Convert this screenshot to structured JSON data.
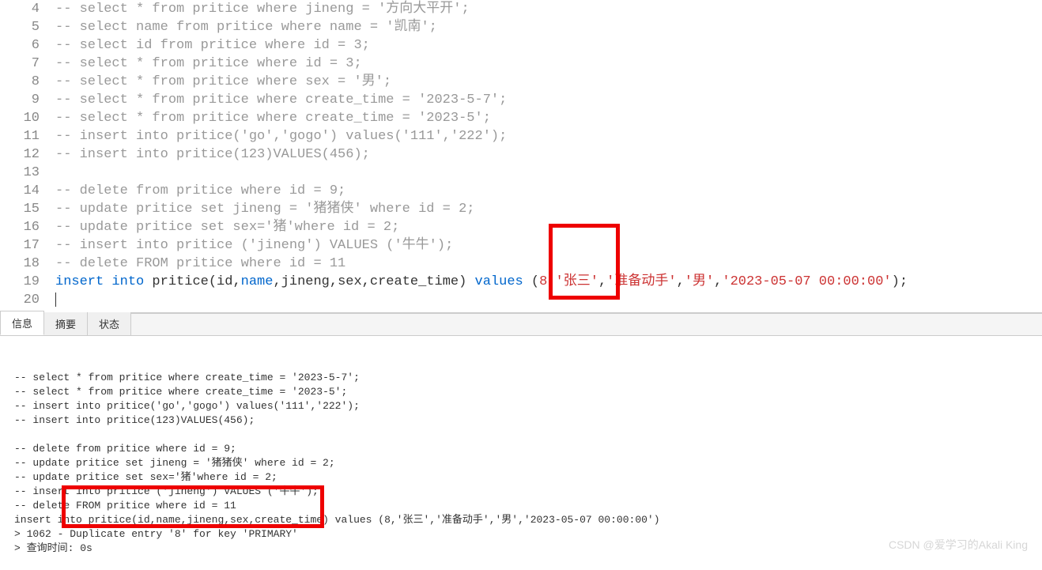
{
  "editor": {
    "lines": [
      {
        "num": "4",
        "segments": [
          {
            "cls": "comment",
            "text": "-- select * from pritice where jineng = '方向大平开';"
          }
        ]
      },
      {
        "num": "5",
        "segments": [
          {
            "cls": "comment",
            "text": "-- select name from pritice where name = '凯南';"
          }
        ]
      },
      {
        "num": "6",
        "segments": [
          {
            "cls": "comment",
            "text": "-- select id from pritice where id = 3;"
          }
        ]
      },
      {
        "num": "7",
        "segments": [
          {
            "cls": "comment",
            "text": "-- select * from pritice where id = 3;"
          }
        ]
      },
      {
        "num": "8",
        "segments": [
          {
            "cls": "comment",
            "text": "-- select * from pritice where sex = '男';"
          }
        ]
      },
      {
        "num": "9",
        "segments": [
          {
            "cls": "comment",
            "text": "-- select * from pritice where create_time = '2023-5-7';"
          }
        ]
      },
      {
        "num": "10",
        "segments": [
          {
            "cls": "comment",
            "text": "-- select * from pritice where create_time = '2023-5';"
          }
        ]
      },
      {
        "num": "11",
        "segments": [
          {
            "cls": "comment",
            "text": "-- insert into pritice('go','gogo') values('111','222');"
          }
        ]
      },
      {
        "num": "12",
        "segments": [
          {
            "cls": "comment",
            "text": "-- insert into pritice(123)VALUES(456);"
          }
        ]
      },
      {
        "num": "13",
        "segments": []
      },
      {
        "num": "14",
        "segments": [
          {
            "cls": "comment",
            "text": "-- delete from pritice where id = 9;"
          }
        ]
      },
      {
        "num": "15",
        "segments": [
          {
            "cls": "comment",
            "text": "-- update pritice set jineng = '猪猪侠' where id = 2;"
          }
        ]
      },
      {
        "num": "16",
        "segments": [
          {
            "cls": "comment",
            "text": "-- update pritice set sex='猪'where id = 2;"
          }
        ]
      },
      {
        "num": "17",
        "segments": [
          {
            "cls": "comment",
            "text": "-- insert into pritice ('jineng') VALUES ('牛牛');"
          }
        ]
      },
      {
        "num": "18",
        "segments": [
          {
            "cls": "comment",
            "text": "-- delete FROM pritice where id = 11"
          }
        ]
      },
      {
        "num": "19",
        "segments": [
          {
            "cls": "keyword",
            "text": "insert"
          },
          {
            "cls": "normal",
            "text": " "
          },
          {
            "cls": "keyword",
            "text": "into"
          },
          {
            "cls": "normal",
            "text": " pritice(id,"
          },
          {
            "cls": "keyword",
            "text": "name"
          },
          {
            "cls": "normal",
            "text": ",jineng,sex,create_time) "
          },
          {
            "cls": "keyword",
            "text": "values"
          },
          {
            "cls": "normal",
            "text": " ("
          },
          {
            "cls": "string",
            "text": "8"
          },
          {
            "cls": "normal",
            "text": ","
          },
          {
            "cls": "string",
            "text": "'张三'"
          },
          {
            "cls": "normal",
            "text": ","
          },
          {
            "cls": "string",
            "text": "'准备动手'"
          },
          {
            "cls": "normal",
            "text": ","
          },
          {
            "cls": "string",
            "text": "'男'"
          },
          {
            "cls": "normal",
            "text": ","
          },
          {
            "cls": "string",
            "text": "'2023-05-07 00:00:00'"
          },
          {
            "cls": "normal",
            "text": ");"
          }
        ]
      },
      {
        "num": "20",
        "segments": [],
        "cursor": true
      }
    ]
  },
  "tabs": {
    "items": [
      "信息",
      "摘要",
      "状态"
    ],
    "activeIndex": 0
  },
  "output": {
    "lines": [
      "-- select * from pritice where create_time = '2023-5-7';",
      "-- select * from pritice where create_time = '2023-5';",
      "-- insert into pritice('go','gogo') values('111','222');",
      "-- insert into pritice(123)VALUES(456);",
      "",
      "-- delete from pritice where id = 9;",
      "-- update pritice set jineng = '猪猪侠' where id = 2;",
      "-- update pritice set sex='猪'where id = 2;",
      "-- insert into pritice ('jineng') VALUES ('牛牛');",
      "-- delete FROM pritice where id = 11",
      "insert into pritice(id,name,jineng,sex,create_time) values (8,'张三','准备动手','男','2023-05-07 00:00:00')",
      "> 1062 - Duplicate entry '8' for key 'PRIMARY'",
      "> 查询时间: 0s"
    ]
  },
  "watermark": "CSDN @爱学习的Akali King"
}
